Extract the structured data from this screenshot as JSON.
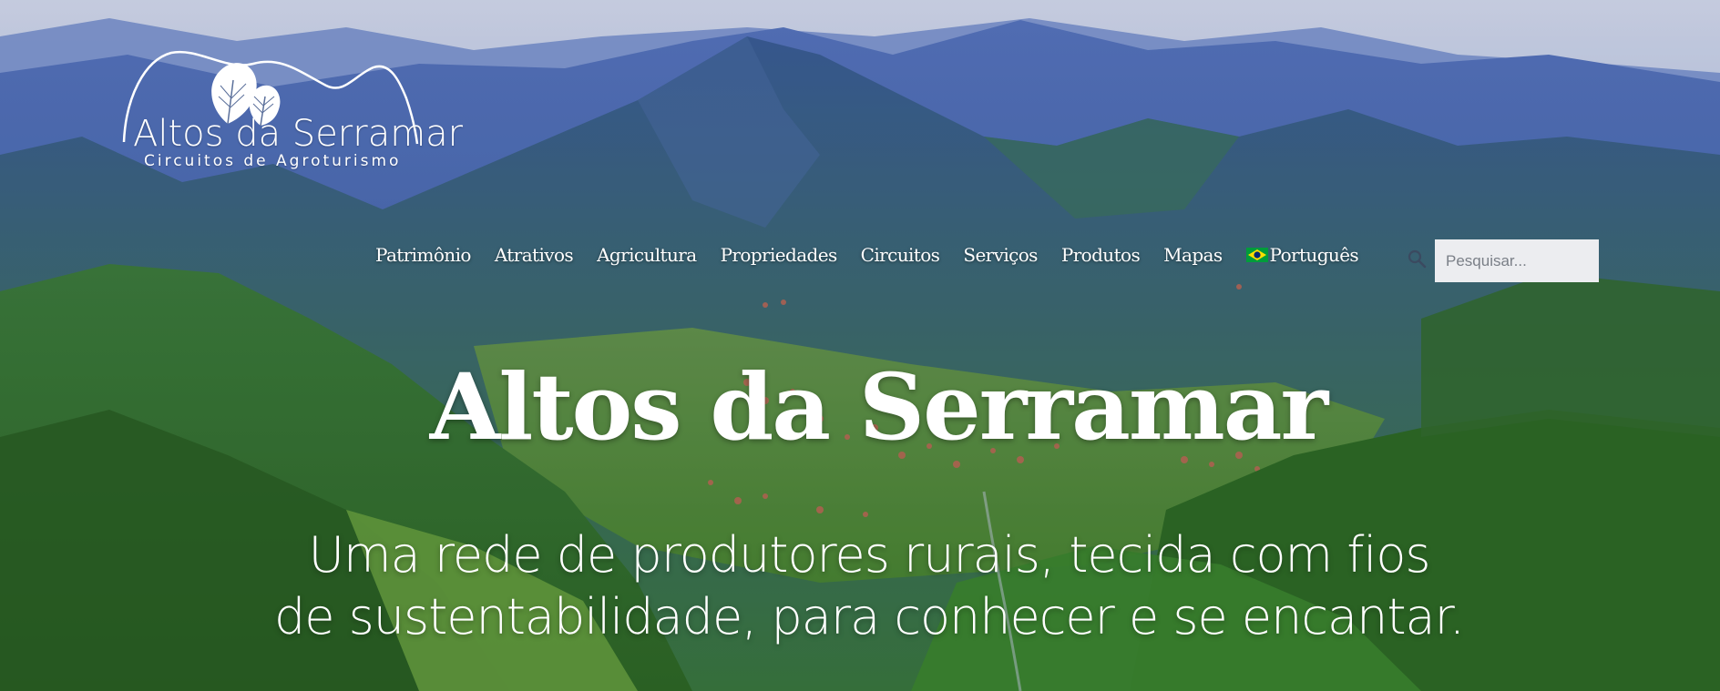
{
  "logo": {
    "name": "Altos da Serramar",
    "tagline": "Circuitos de Agroturismo"
  },
  "nav": {
    "items": [
      {
        "label": "Patrimônio"
      },
      {
        "label": "Atrativos"
      },
      {
        "label": "Agricultura"
      },
      {
        "label": "Propriedades"
      },
      {
        "label": "Circuitos"
      },
      {
        "label": "Serviços"
      },
      {
        "label": "Produtos"
      },
      {
        "label": "Mapas"
      }
    ],
    "language": {
      "label": "Português",
      "flag": "brazil-flag"
    }
  },
  "search": {
    "placeholder": "Pesquisar...",
    "value": "",
    "icon": "search-icon"
  },
  "hero": {
    "title": "Altos da Serramar",
    "subtitle_line1": "Uma rede de produtores rurais, tecida com fios",
    "subtitle_line2": "de sustentabilidade, para conhecer e se encantar."
  },
  "colors": {
    "text": "#ffffff",
    "search_bg": "#ecedf0",
    "flag_green": "#009c3b",
    "flag_yellow": "#ffdf00",
    "flag_blue": "#002776"
  }
}
